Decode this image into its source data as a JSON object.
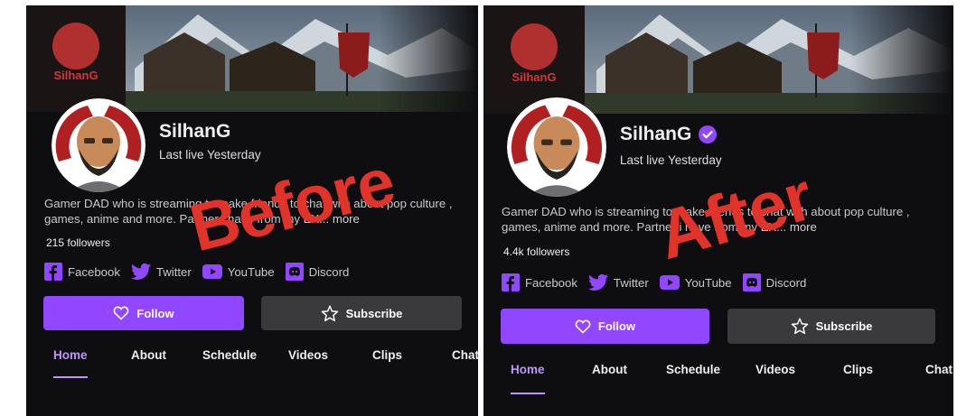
{
  "colors": {
    "brand_purple": "#9147ff",
    "tab_active": "#bf94ff",
    "stamp_red": "#e2332a",
    "panel_bg": "#0e0e10",
    "button_grey": "#3a3a3d"
  },
  "before": {
    "stamp": "Before",
    "channel_name": "SilhanG",
    "last_live": "Last live Yesterday",
    "bio_text": "Gamer DAD who is streaming to make friends to chat with about pop culture , games, anime and more. Partner i have from my EX...",
    "bio_more": "more",
    "followers": "215 followers",
    "socials": [
      {
        "icon": "facebook-icon",
        "label": "Facebook"
      },
      {
        "icon": "twitter-icon",
        "label": "Twitter"
      },
      {
        "icon": "youtube-icon",
        "label": "YouTube"
      },
      {
        "icon": "discord-icon",
        "label": "Discord"
      }
    ],
    "follow_label": "Follow",
    "subscribe_label": "Subscribe",
    "tabs": [
      "Home",
      "About",
      "Schedule",
      "Videos",
      "Clips",
      "Chat"
    ]
  },
  "after": {
    "stamp": "After",
    "channel_name": "SilhanG",
    "verified_icon": "verified-badge-icon",
    "last_live": "Last live Yesterday",
    "bio_text": "Gamer DAD who is streaming to make friends to chat with about pop culture , games, anime and more. Partner i have from my EX...",
    "bio_more": "more",
    "followers": "4.4k followers",
    "socials": [
      {
        "icon": "facebook-icon",
        "label": "Facebook"
      },
      {
        "icon": "twitter-icon",
        "label": "Twitter"
      },
      {
        "icon": "youtube-icon",
        "label": "YouTube"
      },
      {
        "icon": "discord-icon",
        "label": "Discord"
      }
    ],
    "follow_label": "Follow",
    "subscribe_label": "Subscribe",
    "tabs": [
      "Home",
      "About",
      "Schedule",
      "Videos",
      "Clips",
      "Chat"
    ]
  }
}
